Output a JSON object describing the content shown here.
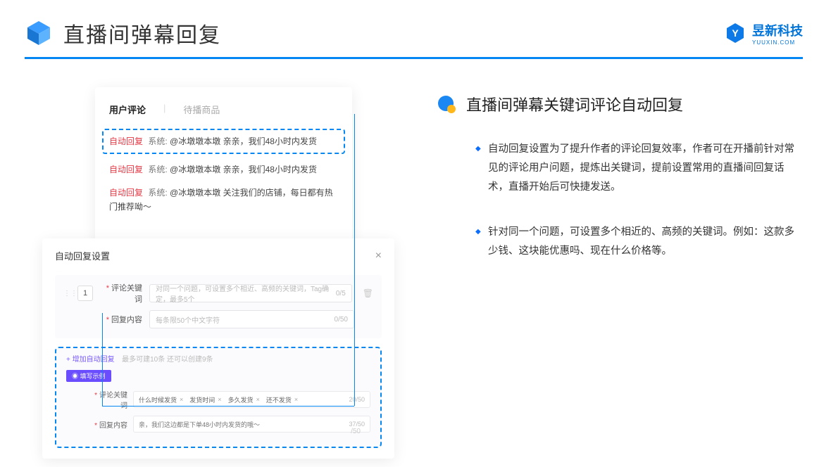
{
  "header": {
    "title": "直播间弹幕回复",
    "brand": "昱新科技",
    "brand_sub": "YUUXIN.COM"
  },
  "comment_card": {
    "tab_active": "用户评论",
    "tab_inactive": "待播商品",
    "tag": "自动回复",
    "sys": "系统:",
    "row1": "@冰墩墩本墩 亲亲，我们48小时内发货",
    "row2": "@冰墩墩本墩 亲亲，我们48小时内发货",
    "row3": "@冰墩墩本墩 关注我们的店铺，每日都有热门推荐呦～"
  },
  "settings": {
    "title": "自动回复设置",
    "num": "1",
    "label_keyword": "评论关键词",
    "placeholder_keyword": "对同一个问题，可设置多个相近、高频的关键词，Tag确定，最多5个",
    "count_keyword": "0/5",
    "label_content": "回复内容",
    "placeholder_content": "每条限50个中文字符",
    "count_content": "0/50",
    "add_link": "+ 增加自动回复",
    "add_hint": "最多可建10条 还可以创建9条",
    "example_badge": "◉ 填写示例",
    "ex_label_kw": "评论关键词",
    "ex_tags": [
      "什么时候发货",
      "发货时间",
      "多久发货",
      "还不发货"
    ],
    "ex_kw_count": "20/50",
    "ex_label_ct": "回复内容",
    "ex_content": "亲，我们这边都是下单48小时内发货的哦～",
    "ex_ct_count": "37/50",
    "ghost": "/50"
  },
  "right": {
    "feature_title": "直播间弹幕关键词评论自动回复",
    "bullet1": "自动回复设置为了提升作者的评论回复效率，作者可在开播前针对常见的评论用户问题，提炼出关键词，提前设置常用的直播间回复话术，直播开始后可快捷发送。",
    "bullet2": "针对同一个问题，可设置多个相近的、高频的关键词。例如：这款多少钱、这块能优惠吗、现在什么价格等。"
  }
}
